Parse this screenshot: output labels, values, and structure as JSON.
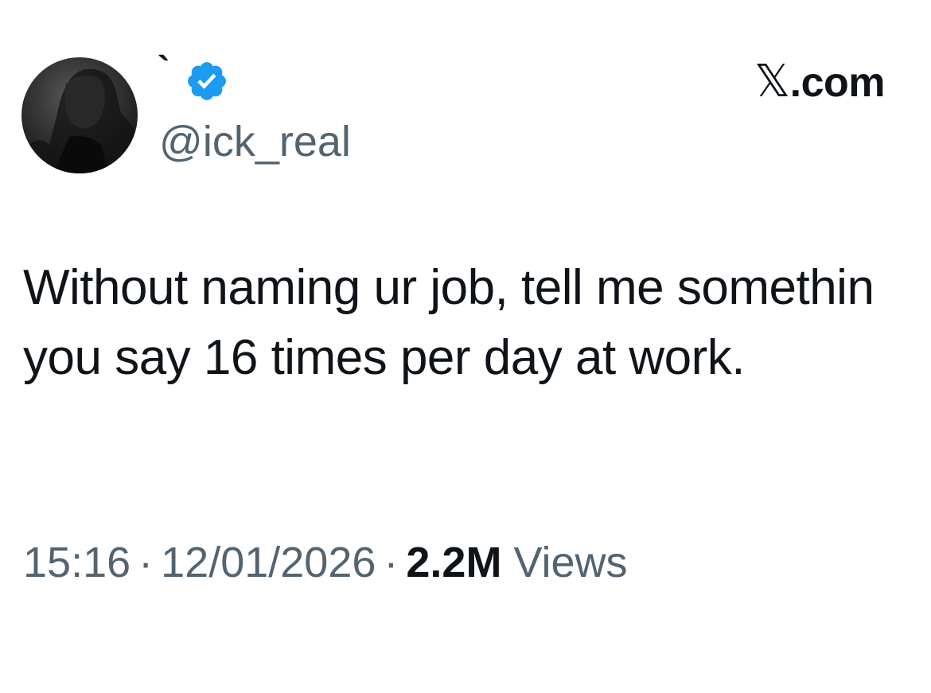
{
  "user": {
    "display_name": "`",
    "handle": "@ick_real",
    "verified": true,
    "verified_color": "#1d9bf0"
  },
  "brand": {
    "x_glyph": "𝕏",
    "suffix": ".com"
  },
  "tweet": {
    "text": "Without naming ur job, tell me somethin you say 16 times per day at work."
  },
  "meta": {
    "time": "15:16",
    "date": "12/01/2026",
    "separator": "·",
    "views_count": "2.2M",
    "views_label": "Views"
  },
  "colors": {
    "text_primary": "#0f1419",
    "text_secondary": "#536471",
    "background": "#ffffff"
  }
}
